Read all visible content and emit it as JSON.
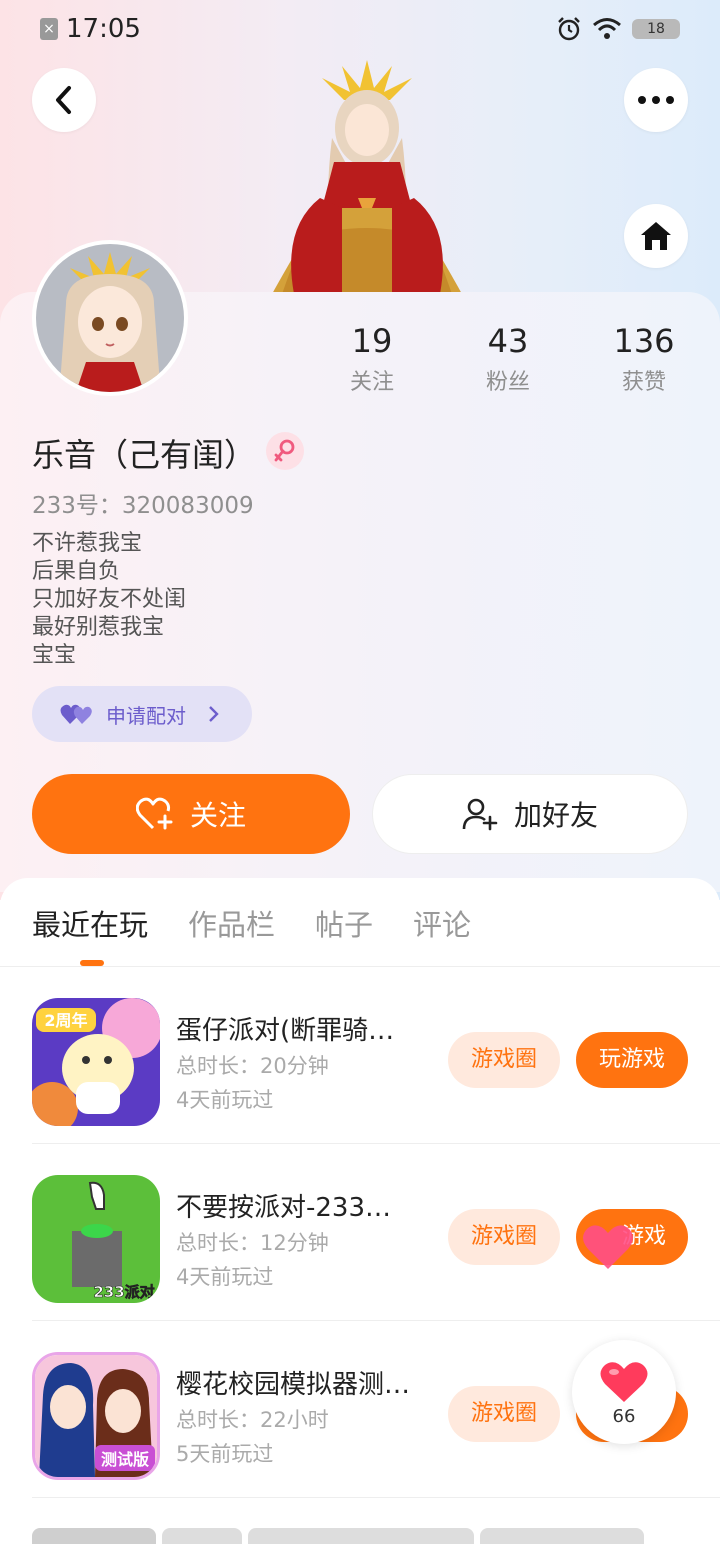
{
  "status_bar": {
    "time": "17:05",
    "battery": "18"
  },
  "stats": [
    {
      "value": "19",
      "label": "关注"
    },
    {
      "value": "43",
      "label": "粉丝"
    },
    {
      "value": "136",
      "label": "获赞"
    }
  ],
  "profile": {
    "nickname": "乐音（己有闺）",
    "uid": "233号：320083009",
    "bio": [
      "不许惹我宝",
      "后果自负",
      "只加好友不处闺",
      "最好别惹我宝",
      "宝宝"
    ]
  },
  "pair_button": {
    "label": "申请配对"
  },
  "actions": {
    "follow": "关注",
    "add_friend": "加好友"
  },
  "tabs": [
    "最近在玩",
    "作品栏",
    "帖子",
    "评论"
  ],
  "games": [
    {
      "name": "蛋仔派对(断罪骑…",
      "duration": "总时长：20分钟",
      "last_played": "4天前玩过",
      "circle": "游戏圈",
      "play": "玩游戏",
      "icon_text": "2周年"
    },
    {
      "name": "不要按派对-233…",
      "duration": "总时长：12分钟",
      "last_played": "4天前玩过",
      "circle": "游戏圈",
      "play": "游戏",
      "icon_text": "233派对"
    },
    {
      "name": "樱花校园模拟器测…",
      "duration": "总时长：22小时",
      "last_played": "5天前玩过",
      "circle": "游戏圈",
      "play": "",
      "icon_text": "测试版"
    }
  ],
  "like_float": {
    "count": "66"
  },
  "colors": {
    "accent": "#ff7310",
    "pair": "#6c5dcc"
  }
}
